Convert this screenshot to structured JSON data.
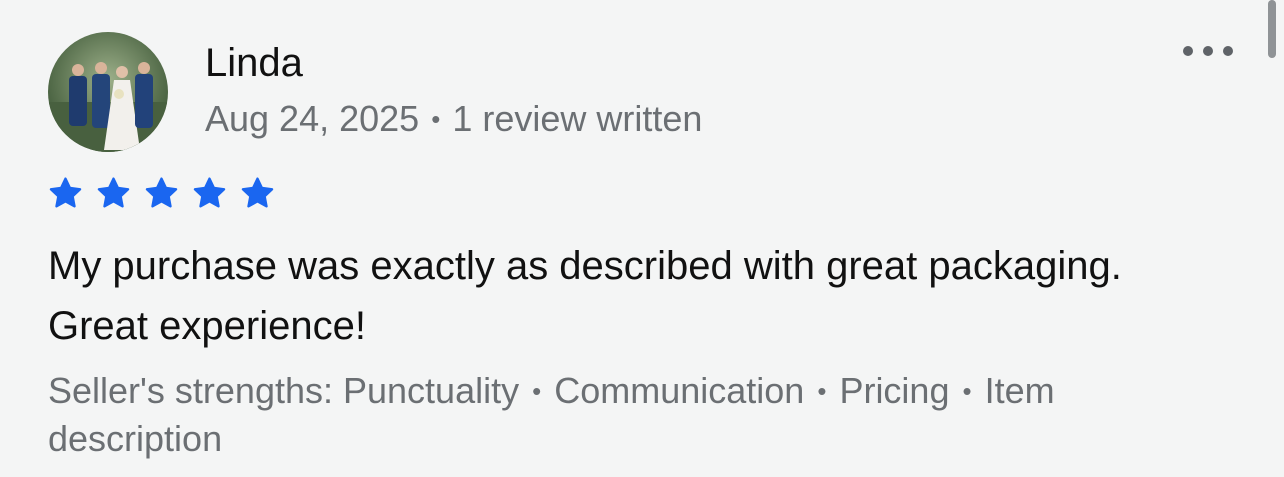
{
  "reviewer": {
    "name": "Linda",
    "date": "Aug 24, 2025",
    "separator": "•",
    "reviews_written": "1 review written"
  },
  "rating": {
    "value": 5,
    "max": 5,
    "color": "#1a66f0"
  },
  "review": {
    "text": "My purchase was exactly as described with great packaging. Great experience!"
  },
  "strengths": {
    "label": "Seller's strengths:",
    "items": [
      "Punctuality",
      "Communication",
      "Pricing",
      "Item description"
    ],
    "separator": "•"
  },
  "icons": {
    "avatar": "reviewer-photo",
    "more": "more-horizontal-icon",
    "star": "star-icon"
  }
}
